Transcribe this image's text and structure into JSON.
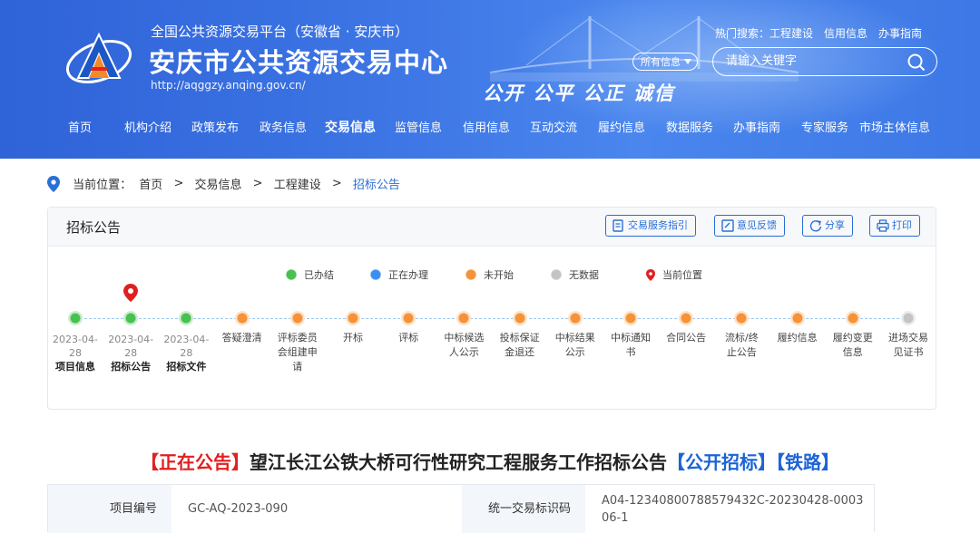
{
  "header": {
    "subtitle": "全国公共资源交易平台（安徽省 · 安庆市）",
    "title": "安庆市公共资源交易中心",
    "url": "http://aqggzy.anqing.gov.cn/",
    "slogan": "公开 公平 公正 诚信",
    "hot_label": "热门搜索：",
    "hot_links": [
      "工程建设",
      "信用信息",
      "办事指南"
    ],
    "search_scope": "所有信息",
    "search_placeholder": "请输入关键字"
  },
  "nav": [
    "首页",
    "机构介绍",
    "政策发布",
    "政务信息",
    "交易信息",
    "监管信息",
    "信用信息",
    "互动交流",
    "履约信息",
    "数据服务",
    "办事指南",
    "专家服务",
    "市场主体信息"
  ],
  "nav_active": "交易信息",
  "breadcrumb": {
    "label": "当前位置：",
    "items": [
      "首页",
      "交易信息",
      "工程建设",
      "招标公告"
    ],
    "sep": ">"
  },
  "panel": {
    "title": "招标公告",
    "buttons": [
      "交易服务指引",
      "意见反馈",
      "分享",
      "打印"
    ],
    "legend": [
      {
        "label": "已办结",
        "color": "#46c152"
      },
      {
        "label": "正在办理",
        "color": "#3a8ff0"
      },
      {
        "label": "未开始",
        "color": "#f5923a"
      },
      {
        "label": "无数据",
        "color": "#c4c4c4"
      },
      {
        "label": "当前位置",
        "color": "#e02020"
      }
    ],
    "steps": [
      {
        "date": "2023-04-28",
        "label": "项目信息",
        "status": "done"
      },
      {
        "date": "2023-04-28",
        "label": "招标公告",
        "status": "done"
      },
      {
        "date": "2023-04-28",
        "label": "招标文件",
        "status": "done"
      },
      {
        "date": "",
        "label": "答疑澄清",
        "status": "pending"
      },
      {
        "date": "",
        "label": "评标委员会组建申请",
        "status": "pending"
      },
      {
        "date": "",
        "label": "开标",
        "status": "pending"
      },
      {
        "date": "",
        "label": "评标",
        "status": "pending"
      },
      {
        "date": "",
        "label": "中标候选人公示",
        "status": "pending"
      },
      {
        "date": "",
        "label": "投标保证金退还",
        "status": "pending"
      },
      {
        "date": "",
        "label": "中标结果公示",
        "status": "pending"
      },
      {
        "date": "",
        "label": "中标通知书",
        "status": "pending"
      },
      {
        "date": "",
        "label": "合同公告",
        "status": "pending"
      },
      {
        "date": "",
        "label": "流标/终止公告",
        "status": "pending"
      },
      {
        "date": "",
        "label": "履约信息",
        "status": "pending"
      },
      {
        "date": "",
        "label": "履约变更信息",
        "status": "pending"
      },
      {
        "date": "",
        "label": "进场交易见证书",
        "status": "nodata"
      }
    ]
  },
  "notice": {
    "status": "【正在公告】",
    "title": "望江长江公铁大桥可行性研究工程服务工作招标公告",
    "tag1": "【公开招标】",
    "tag2": "【铁路】"
  },
  "info": {
    "project_no_label": "项目编号",
    "project_no": "GC-AQ-2023-090",
    "code_label": "统一交易标识码",
    "code": "A04-12340800788579432C-20230428-000306-1"
  }
}
